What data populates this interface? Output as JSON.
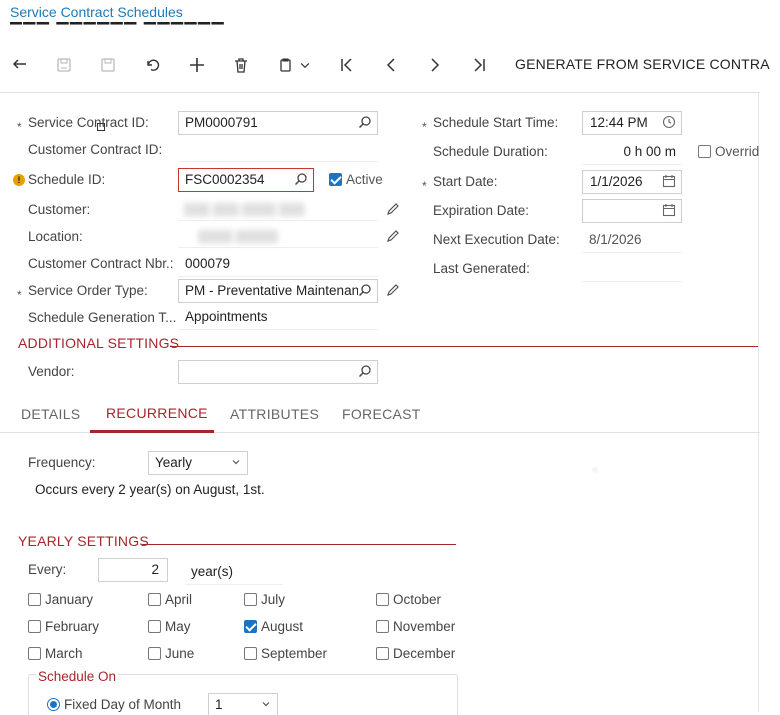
{
  "header": {
    "breadcrumb": "Service Contract Schedules"
  },
  "toolbar": {
    "buttons": [
      "back-icon",
      "save-close-icon",
      "save-icon",
      "undo-icon",
      "add-icon",
      "delete-icon",
      "copy-paste-icon",
      "first-icon",
      "prev-icon",
      "next-icon",
      "last-icon"
    ],
    "action_label": "GENERATE FROM SERVICE CONTRA"
  },
  "form": {
    "service_contract_id": {
      "label": "Service Contract ID:",
      "value": "PM0000791"
    },
    "customer_contract_id": {
      "label": "Customer Contract ID:",
      "value": ""
    },
    "schedule_id": {
      "label": "Schedule ID:",
      "value": "FSC0002354"
    },
    "active": {
      "label": "Active",
      "checked": true
    },
    "customer": {
      "label": "Customer:"
    },
    "location": {
      "label": "Location:"
    },
    "customer_contract_nbr": {
      "label": "Customer Contract Nbr.:",
      "value": "000079"
    },
    "service_order_type": {
      "label": "Service Order Type:",
      "value": "PM - Preventative Maintenanc"
    },
    "schedule_generation_type": {
      "label": "Schedule Generation T...",
      "value": "Appointments"
    },
    "schedule_start_time": {
      "label": "Schedule Start Time:",
      "value": "12:44 PM"
    },
    "schedule_duration": {
      "label": "Schedule Duration:",
      "value": "0 h 00 m"
    },
    "override": {
      "label": "Overrid",
      "checked": false
    },
    "start_date": {
      "label": "Start Date:",
      "value": "1/1/2026"
    },
    "expiration_date": {
      "label": "Expiration Date:",
      "value": ""
    },
    "next_execution_date": {
      "label": "Next Execution Date:",
      "value": "8/1/2026"
    },
    "last_generated": {
      "label": "Last Generated:",
      "value": ""
    }
  },
  "additional_settings": {
    "title": "ADDITIONAL SETTINGS",
    "vendor": {
      "label": "Vendor:",
      "value": ""
    }
  },
  "tabs": [
    {
      "label": "DETAILS",
      "active": false
    },
    {
      "label": "RECURRENCE",
      "active": true
    },
    {
      "label": "ATTRIBUTES",
      "active": false
    },
    {
      "label": "FORECAST",
      "active": false
    }
  ],
  "recurrence": {
    "frequency": {
      "label": "Frequency:",
      "value": "Yearly"
    },
    "summary": "Occurs every 2 year(s) on August, 1st."
  },
  "yearly_settings": {
    "title": "YEARLY SETTINGS",
    "every": {
      "label": "Every:",
      "value": "2",
      "unit": "year(s)"
    },
    "months": [
      {
        "label": "January",
        "checked": false
      },
      {
        "label": "April",
        "checked": false
      },
      {
        "label": "July",
        "checked": false
      },
      {
        "label": "October",
        "checked": false
      },
      {
        "label": "February",
        "checked": false
      },
      {
        "label": "May",
        "checked": false
      },
      {
        "label": "August",
        "checked": true
      },
      {
        "label": "November",
        "checked": false
      },
      {
        "label": "March",
        "checked": false
      },
      {
        "label": "June",
        "checked": false
      },
      {
        "label": "September",
        "checked": false
      },
      {
        "label": "December",
        "checked": false
      }
    ],
    "schedule_on": {
      "title": "Schedule On",
      "fixed_day_label": "Fixed Day of Month",
      "fixed_day_value": "1"
    }
  },
  "colors": {
    "accent": "#a6262b",
    "link": "#1a7bb9",
    "checkbox": "#1c73c3"
  }
}
